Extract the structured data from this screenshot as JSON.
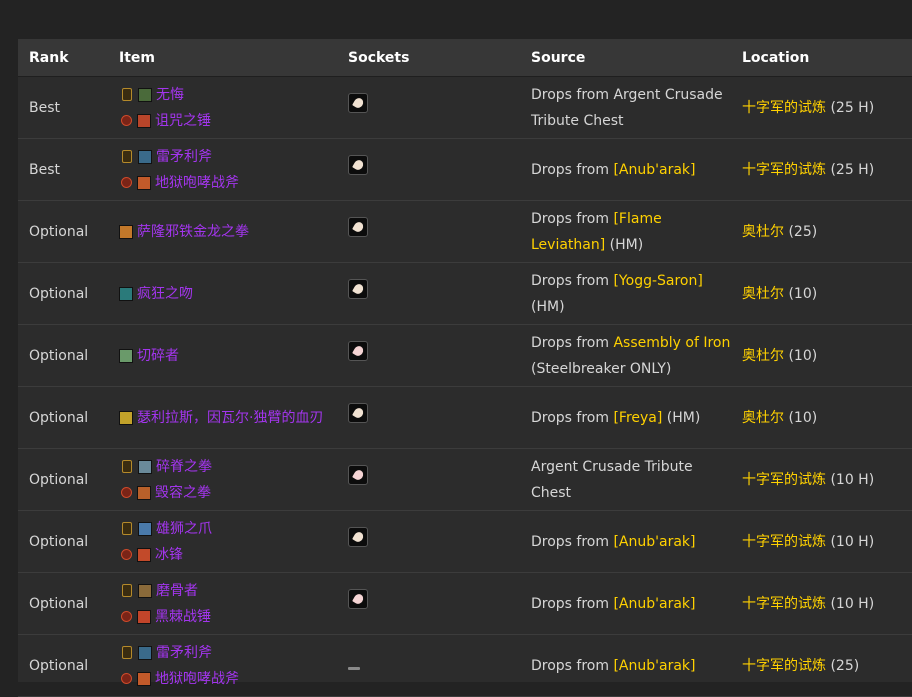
{
  "colors": {
    "item": "#a335ee",
    "npc": "#ffd100",
    "zone": "#ffd100"
  },
  "headers": {
    "rank": "Rank",
    "item": "Item",
    "sockets": "Sockets",
    "source": "Source",
    "location": "Location"
  },
  "rows": [
    {
      "rank": "Best",
      "item1": "无悔",
      "item2": "诅咒之锤",
      "src_pre": "Drops from Argent Crusade Tribute Chest",
      "src_npc": "",
      "src_post": "",
      "zone": "十字军的试炼",
      "zone_suffix": " (25 H)"
    },
    {
      "rank": "Best",
      "item1": "雷矛利斧",
      "item2": "地狱咆哮战斧",
      "src_pre": "Drops from ",
      "src_npc": "[Anub'arak]",
      "src_post": "",
      "zone": "十字军的试炼",
      "zone_suffix": " (25 H)"
    },
    {
      "rank": "Optional",
      "item1": "萨隆邪铁金龙之拳",
      "item2": "",
      "src_pre": "Drops from ",
      "src_npc": "[Flame Leviathan]",
      "src_post": " (HM)",
      "zone": "奥杜尔",
      "zone_suffix": " (25)"
    },
    {
      "rank": "Optional",
      "item1": "疯狂之吻",
      "item2": "",
      "src_pre": "Drops from ",
      "src_npc": "[Yogg-Saron]",
      "src_post": " (HM)",
      "zone": "奥杜尔",
      "zone_suffix": " (10)"
    },
    {
      "rank": "Optional",
      "item1": "切碎者",
      "item2": "",
      "src_pre": "Drops from ",
      "src_npc": "Assembly of Iron",
      "src_post": " (Steelbreaker ONLY)",
      "zone": "奥杜尔",
      "zone_suffix": " (10)"
    },
    {
      "rank": "Optional",
      "item1": "瑟利拉斯，因瓦尔·独臂的血刃",
      "item2": "",
      "src_pre": "Drops from ",
      "src_npc": "[Freya]",
      "src_post": " (HM)",
      "zone": "奥杜尔",
      "zone_suffix": " (10)"
    },
    {
      "rank": "Optional",
      "item1": "碎脊之拳",
      "item2": "毁容之拳",
      "src_pre": "Argent Crusade Tribute Chest",
      "src_npc": "",
      "src_post": "",
      "zone": "十字军的试炼",
      "zone_suffix": " (10 H)"
    },
    {
      "rank": "Optional",
      "item1": "雄狮之爪",
      "item2": "冰锋",
      "src_pre": "Drops from ",
      "src_npc": "[Anub'arak]",
      "src_post": "",
      "zone": "十字军的试炼",
      "zone_suffix": " (10 H)"
    },
    {
      "rank": "Optional",
      "item1": "磨骨者",
      "item2": "黑棘战锤",
      "src_pre": "Drops from ",
      "src_npc": "[Anub'arak]",
      "src_post": "",
      "zone": "十字军的试炼",
      "zone_suffix": " (10 H)"
    },
    {
      "rank": "Optional",
      "item1": "雷矛利斧",
      "item2": "地狱咆哮战斧",
      "src_pre": "Drops from ",
      "src_npc": "[Anub'arak]",
      "src_post": "",
      "zone": "十字军的试炼",
      "zone_suffix": " (25)"
    }
  ]
}
